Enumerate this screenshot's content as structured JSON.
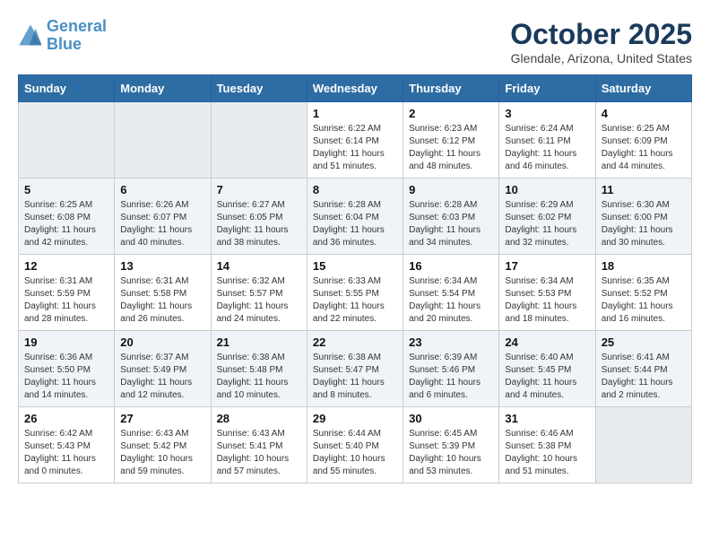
{
  "header": {
    "logo_line1": "General",
    "logo_line2": "Blue",
    "month": "October 2025",
    "location": "Glendale, Arizona, United States"
  },
  "weekdays": [
    "Sunday",
    "Monday",
    "Tuesday",
    "Wednesday",
    "Thursday",
    "Friday",
    "Saturday"
  ],
  "weeks": [
    [
      {
        "day": "",
        "sunrise": "",
        "sunset": "",
        "daylight": "",
        "empty": true
      },
      {
        "day": "",
        "sunrise": "",
        "sunset": "",
        "daylight": "",
        "empty": true
      },
      {
        "day": "",
        "sunrise": "",
        "sunset": "",
        "daylight": "",
        "empty": true
      },
      {
        "day": "1",
        "sunrise": "Sunrise: 6:22 AM",
        "sunset": "Sunset: 6:14 PM",
        "daylight": "Daylight: 11 hours and 51 minutes."
      },
      {
        "day": "2",
        "sunrise": "Sunrise: 6:23 AM",
        "sunset": "Sunset: 6:12 PM",
        "daylight": "Daylight: 11 hours and 48 minutes."
      },
      {
        "day": "3",
        "sunrise": "Sunrise: 6:24 AM",
        "sunset": "Sunset: 6:11 PM",
        "daylight": "Daylight: 11 hours and 46 minutes."
      },
      {
        "day": "4",
        "sunrise": "Sunrise: 6:25 AM",
        "sunset": "Sunset: 6:09 PM",
        "daylight": "Daylight: 11 hours and 44 minutes."
      }
    ],
    [
      {
        "day": "5",
        "sunrise": "Sunrise: 6:25 AM",
        "sunset": "Sunset: 6:08 PM",
        "daylight": "Daylight: 11 hours and 42 minutes."
      },
      {
        "day": "6",
        "sunrise": "Sunrise: 6:26 AM",
        "sunset": "Sunset: 6:07 PM",
        "daylight": "Daylight: 11 hours and 40 minutes."
      },
      {
        "day": "7",
        "sunrise": "Sunrise: 6:27 AM",
        "sunset": "Sunset: 6:05 PM",
        "daylight": "Daylight: 11 hours and 38 minutes."
      },
      {
        "day": "8",
        "sunrise": "Sunrise: 6:28 AM",
        "sunset": "Sunset: 6:04 PM",
        "daylight": "Daylight: 11 hours and 36 minutes."
      },
      {
        "day": "9",
        "sunrise": "Sunrise: 6:28 AM",
        "sunset": "Sunset: 6:03 PM",
        "daylight": "Daylight: 11 hours and 34 minutes."
      },
      {
        "day": "10",
        "sunrise": "Sunrise: 6:29 AM",
        "sunset": "Sunset: 6:02 PM",
        "daylight": "Daylight: 11 hours and 32 minutes."
      },
      {
        "day": "11",
        "sunrise": "Sunrise: 6:30 AM",
        "sunset": "Sunset: 6:00 PM",
        "daylight": "Daylight: 11 hours and 30 minutes."
      }
    ],
    [
      {
        "day": "12",
        "sunrise": "Sunrise: 6:31 AM",
        "sunset": "Sunset: 5:59 PM",
        "daylight": "Daylight: 11 hours and 28 minutes."
      },
      {
        "day": "13",
        "sunrise": "Sunrise: 6:31 AM",
        "sunset": "Sunset: 5:58 PM",
        "daylight": "Daylight: 11 hours and 26 minutes."
      },
      {
        "day": "14",
        "sunrise": "Sunrise: 6:32 AM",
        "sunset": "Sunset: 5:57 PM",
        "daylight": "Daylight: 11 hours and 24 minutes."
      },
      {
        "day": "15",
        "sunrise": "Sunrise: 6:33 AM",
        "sunset": "Sunset: 5:55 PM",
        "daylight": "Daylight: 11 hours and 22 minutes."
      },
      {
        "day": "16",
        "sunrise": "Sunrise: 6:34 AM",
        "sunset": "Sunset: 5:54 PM",
        "daylight": "Daylight: 11 hours and 20 minutes."
      },
      {
        "day": "17",
        "sunrise": "Sunrise: 6:34 AM",
        "sunset": "Sunset: 5:53 PM",
        "daylight": "Daylight: 11 hours and 18 minutes."
      },
      {
        "day": "18",
        "sunrise": "Sunrise: 6:35 AM",
        "sunset": "Sunset: 5:52 PM",
        "daylight": "Daylight: 11 hours and 16 minutes."
      }
    ],
    [
      {
        "day": "19",
        "sunrise": "Sunrise: 6:36 AM",
        "sunset": "Sunset: 5:50 PM",
        "daylight": "Daylight: 11 hours and 14 minutes."
      },
      {
        "day": "20",
        "sunrise": "Sunrise: 6:37 AM",
        "sunset": "Sunset: 5:49 PM",
        "daylight": "Daylight: 11 hours and 12 minutes."
      },
      {
        "day": "21",
        "sunrise": "Sunrise: 6:38 AM",
        "sunset": "Sunset: 5:48 PM",
        "daylight": "Daylight: 11 hours and 10 minutes."
      },
      {
        "day": "22",
        "sunrise": "Sunrise: 6:38 AM",
        "sunset": "Sunset: 5:47 PM",
        "daylight": "Daylight: 11 hours and 8 minutes."
      },
      {
        "day": "23",
        "sunrise": "Sunrise: 6:39 AM",
        "sunset": "Sunset: 5:46 PM",
        "daylight": "Daylight: 11 hours and 6 minutes."
      },
      {
        "day": "24",
        "sunrise": "Sunrise: 6:40 AM",
        "sunset": "Sunset: 5:45 PM",
        "daylight": "Daylight: 11 hours and 4 minutes."
      },
      {
        "day": "25",
        "sunrise": "Sunrise: 6:41 AM",
        "sunset": "Sunset: 5:44 PM",
        "daylight": "Daylight: 11 hours and 2 minutes."
      }
    ],
    [
      {
        "day": "26",
        "sunrise": "Sunrise: 6:42 AM",
        "sunset": "Sunset: 5:43 PM",
        "daylight": "Daylight: 11 hours and 0 minutes."
      },
      {
        "day": "27",
        "sunrise": "Sunrise: 6:43 AM",
        "sunset": "Sunset: 5:42 PM",
        "daylight": "Daylight: 10 hours and 59 minutes."
      },
      {
        "day": "28",
        "sunrise": "Sunrise: 6:43 AM",
        "sunset": "Sunset: 5:41 PM",
        "daylight": "Daylight: 10 hours and 57 minutes."
      },
      {
        "day": "29",
        "sunrise": "Sunrise: 6:44 AM",
        "sunset": "Sunset: 5:40 PM",
        "daylight": "Daylight: 10 hours and 55 minutes."
      },
      {
        "day": "30",
        "sunrise": "Sunrise: 6:45 AM",
        "sunset": "Sunset: 5:39 PM",
        "daylight": "Daylight: 10 hours and 53 minutes."
      },
      {
        "day": "31",
        "sunrise": "Sunrise: 6:46 AM",
        "sunset": "Sunset: 5:38 PM",
        "daylight": "Daylight: 10 hours and 51 minutes."
      },
      {
        "day": "",
        "sunrise": "",
        "sunset": "",
        "daylight": "",
        "empty": true
      }
    ]
  ]
}
